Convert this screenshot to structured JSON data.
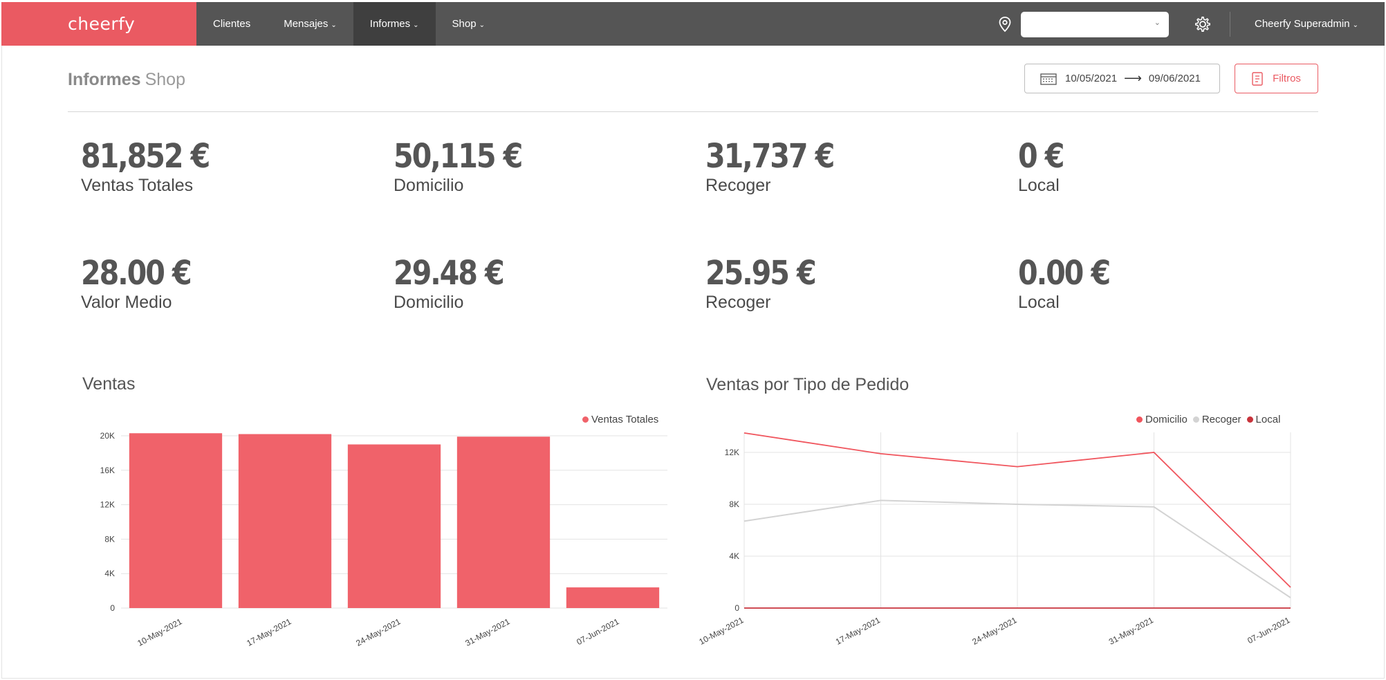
{
  "app": {
    "brand": "cheerfy"
  },
  "nav": {
    "items": [
      {
        "label": "Clientes",
        "has_menu": false,
        "active": false
      },
      {
        "label": "Mensajes",
        "has_menu": true,
        "active": false
      },
      {
        "label": "Informes",
        "has_menu": true,
        "active": true
      },
      {
        "label": "Shop",
        "has_menu": true,
        "active": false
      }
    ],
    "location_select": "",
    "user": "Cheerfy Superadmin"
  },
  "header": {
    "title_bold": "Informes",
    "title_light": "Shop",
    "date_from": "10/05/2021",
    "date_to": "09/06/2021",
    "filters_label": "Filtros"
  },
  "stats": {
    "totals": [
      {
        "value": "81,852 €",
        "label": "Ventas Totales"
      },
      {
        "value": "50,115 €",
        "label": "Domicilio"
      },
      {
        "value": "31,737 €",
        "label": "Recoger"
      },
      {
        "value": "0 €",
        "label": "Local"
      }
    ],
    "averages": [
      {
        "value": "28.00 €",
        "label": "Valor Medio"
      },
      {
        "value": "29.48 €",
        "label": "Domicilio"
      },
      {
        "value": "25.95 €",
        "label": "Recoger"
      },
      {
        "value": "0.00 €",
        "label": "Local"
      }
    ]
  },
  "colors": {
    "accent": "#ea5a62",
    "bar": "#f0626a",
    "domicilio": "#f0555d",
    "recoger": "#d3d3d3",
    "local": "#c8333b",
    "topbar": "#555555"
  },
  "chart_data": [
    {
      "type": "bar",
      "title": "Ventas",
      "categories": [
        "10-May-2021",
        "17-May-2021",
        "24-May-2021",
        "31-May-2021",
        "07-Jun-2021"
      ],
      "series": [
        {
          "name": "Ventas Totales",
          "values": [
            20300,
            20200,
            19000,
            19900,
            2400
          ]
        }
      ],
      "yticks": [
        "0",
        "4K",
        "8K",
        "12K",
        "16K",
        "20K"
      ],
      "ylim": [
        0,
        20000
      ],
      "legend": "top-right",
      "grid": true
    },
    {
      "type": "line",
      "title": "Ventas por Tipo de Pedido",
      "categories": [
        "10-May-2021",
        "17-May-2021",
        "24-May-2021",
        "31-May-2021",
        "07-Jun-2021"
      ],
      "series": [
        {
          "name": "Domicilio",
          "values": [
            13500,
            11900,
            10900,
            12000,
            1600
          ]
        },
        {
          "name": "Recoger",
          "values": [
            6700,
            8300,
            8000,
            7800,
            800
          ]
        },
        {
          "name": "Local",
          "values": [
            0,
            0,
            0,
            0,
            0
          ]
        }
      ],
      "yticks": [
        "0",
        "4K",
        "8K",
        "12K"
      ],
      "ylim": [
        0,
        12000
      ],
      "legend": "top-right",
      "grid": true
    }
  ]
}
